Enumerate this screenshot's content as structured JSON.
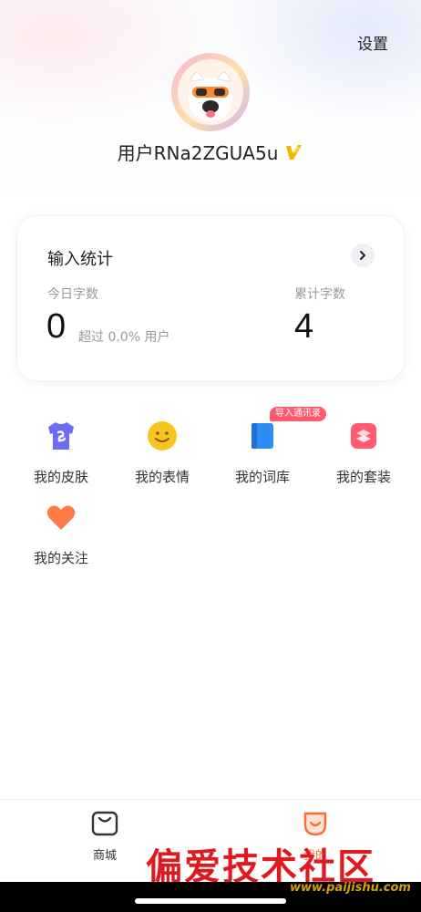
{
  "header": {
    "settings_label": "设置",
    "username": "用户RNa2ZGUA5u"
  },
  "stats": {
    "title": "输入统计",
    "today_label": "今日字数",
    "today_value": "0",
    "today_note": "超过 0.0% 用户",
    "total_label": "累计字数",
    "total_value": "4"
  },
  "grid": {
    "items": [
      {
        "label": "我的皮肤",
        "icon": "tshirt-icon"
      },
      {
        "label": "我的表情",
        "icon": "smiley-icon"
      },
      {
        "label": "我的词库",
        "icon": "book-icon",
        "badge": "导入通讯录"
      },
      {
        "label": "我的套装",
        "icon": "suit-icon"
      },
      {
        "label": "我的关注",
        "icon": "heart-icon"
      }
    ]
  },
  "tabbar": {
    "tabs": [
      {
        "label": "商城",
        "icon": "shop-bag-icon"
      },
      {
        "label": "我的",
        "icon": "mine-icon",
        "active": true
      }
    ]
  },
  "watermark": {
    "text": "偏爱技术社区",
    "url": "www.paijishu.com"
  },
  "colors": {
    "accent": "#ff6a2b",
    "badge": "#ff5a6e",
    "tshirt": "#6b6ef5",
    "smiley": "#f7c520",
    "book": "#2f8bf5",
    "suit": "#ff5a6e",
    "heart": "#ff7a45"
  }
}
